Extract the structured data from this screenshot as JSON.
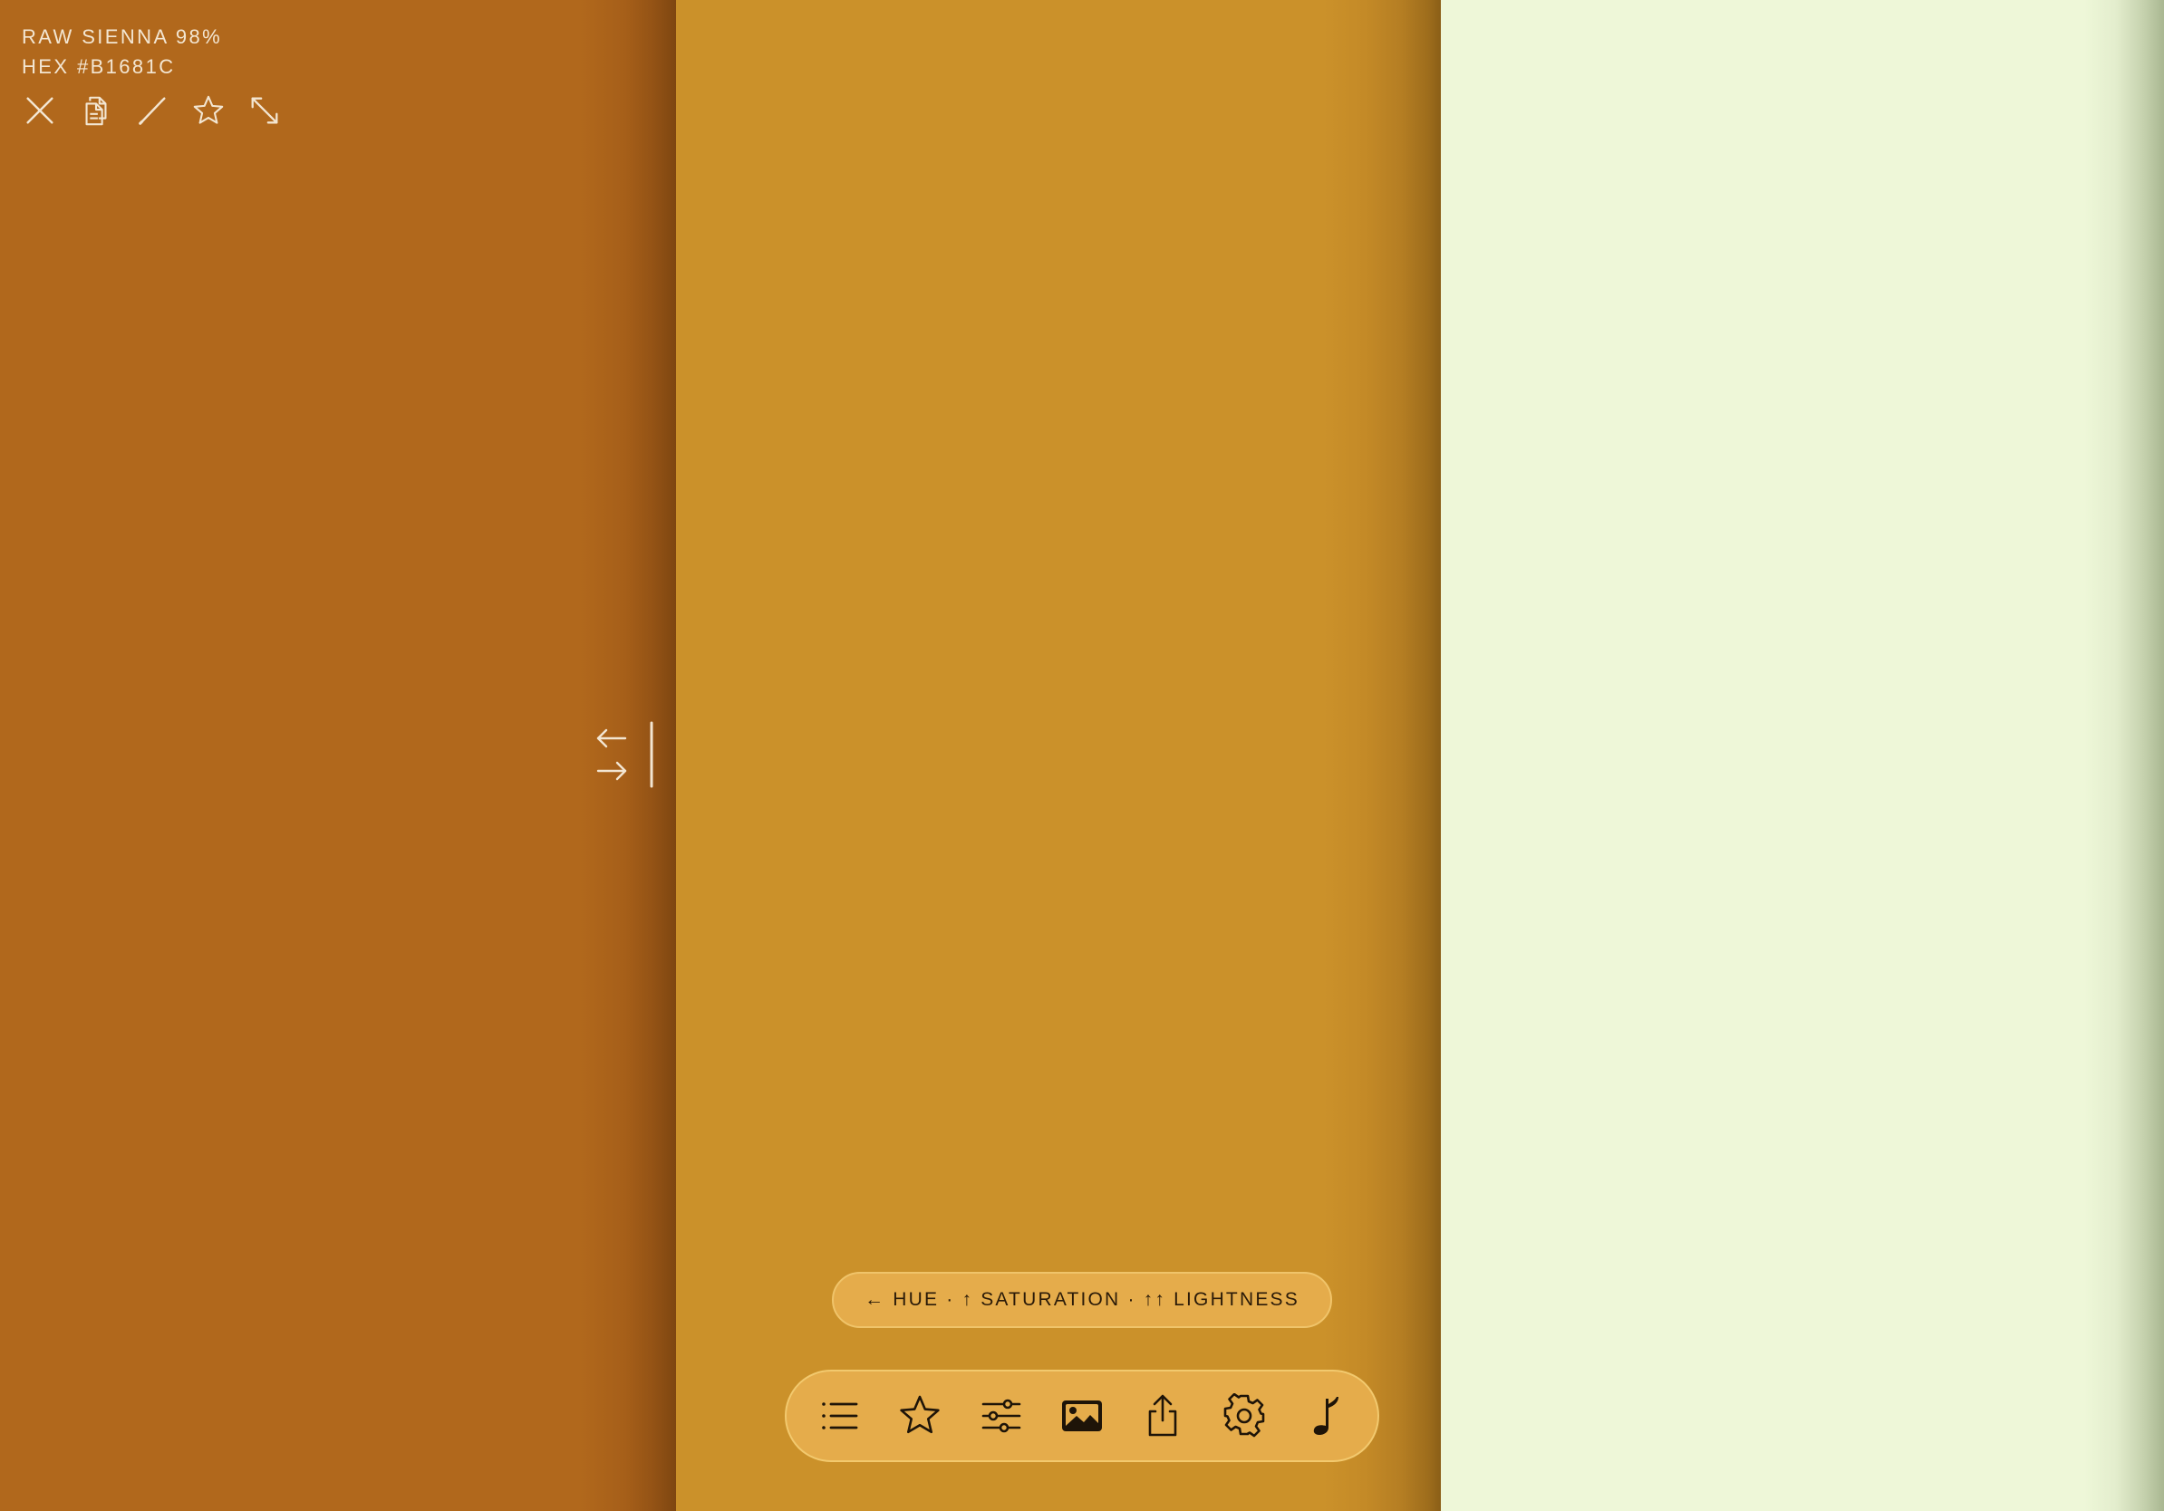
{
  "colors": {
    "left_panel": "#B1681C",
    "middle_panel": "#CB912A",
    "right_panel": "#EEF7D8",
    "pill_background": "#E5AC4B",
    "info_text": "#F3E6D2",
    "dark_icon": "#1E1408"
  },
  "info": {
    "name_line": "RAW SIENNA 98%",
    "hex_line": "HEX #B1681C"
  },
  "top_toolbar": {
    "icons": [
      "close-icon",
      "copy-icon",
      "edit-pencil-icon",
      "star-icon",
      "expand-icon"
    ]
  },
  "resize_handle": {
    "icons": [
      "arrow-left-icon",
      "arrow-right-icon"
    ]
  },
  "hint": {
    "text": "← HUE · ↑ SATURATION · ↑↑ LIGHTNESS"
  },
  "dock": {
    "icons": [
      "list-icon",
      "star-icon",
      "sliders-icon",
      "image-icon",
      "share-icon",
      "settings-gear-icon",
      "music-note-icon"
    ]
  }
}
